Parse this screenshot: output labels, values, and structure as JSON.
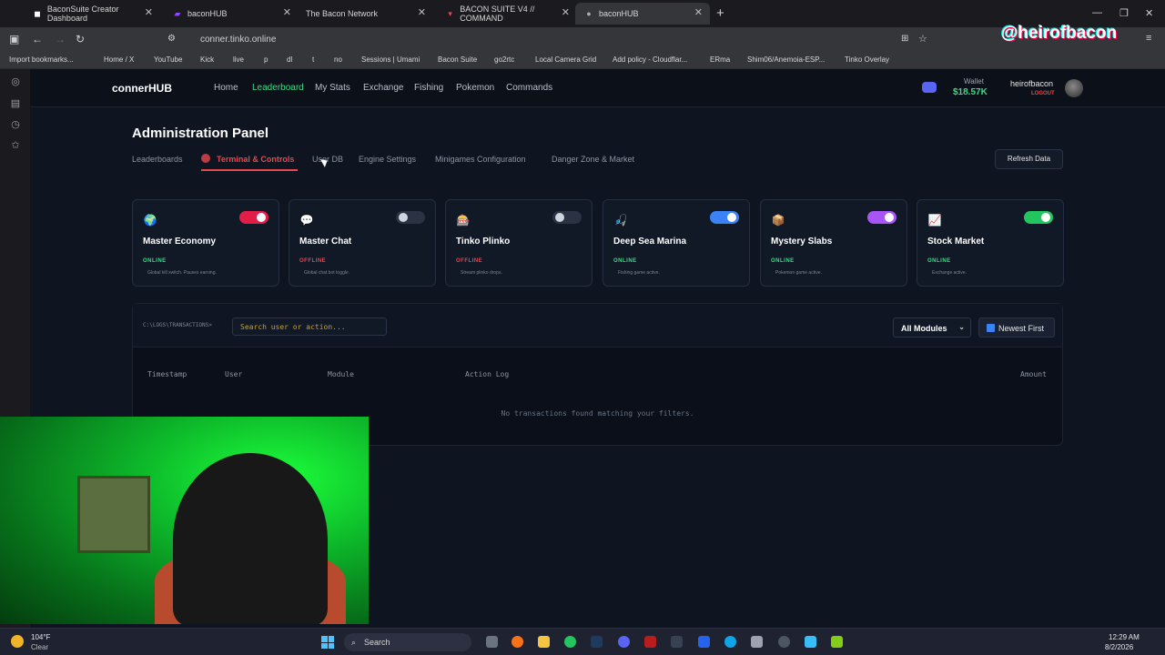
{
  "browser": {
    "tabs": [
      {
        "label": "BaconSuite Creator Dashboard",
        "active": false
      },
      {
        "label": "baconHUB",
        "active": false
      },
      {
        "label": "The Bacon Network",
        "active": false
      },
      {
        "label": "BACON SUITE V4 // COMMAND",
        "active": false
      },
      {
        "label": "baconHUB",
        "active": true
      }
    ],
    "url": "conner.tinko.online",
    "overlay_handle": "@heirofbacon",
    "bookmarks": [
      "Import bookmarks...",
      "Home / X",
      "YouTube",
      "Kick",
      "live",
      "p",
      "dl",
      "t",
      "no",
      "Sessions | Umami",
      "Bacon Suite",
      "go2rtc",
      "Local Camera Grid",
      "Add policy - Cloudflar...",
      "ERma",
      "Shim06/Anemoia-ESP...",
      "Tinko Overlay"
    ]
  },
  "nav": {
    "brand": "connerHUB",
    "links": [
      "Home",
      "Leaderboard",
      "My Stats",
      "Exchange",
      "Fishing",
      "Pokemon",
      "Commands"
    ],
    "active_link": "Leaderboard",
    "wallet_label": "Wallet",
    "wallet_value": "$18.57K",
    "username": "heirofbacon",
    "logout": "LOGOUT"
  },
  "panel": {
    "title": "Administration Panel",
    "tabs": [
      "Leaderboards",
      "Terminal & Controls",
      "User DB",
      "Engine Settings",
      "Minigames Configuration",
      "Danger Zone & Market"
    ],
    "active_tab": "Terminal & Controls",
    "refresh_label": "Refresh Data"
  },
  "modules": [
    {
      "title": "Master Economy",
      "status": "ONLINE",
      "desc": "Global kill switch. Pauses earning.",
      "on": true,
      "color": "#e11d48",
      "icon": "globe-icon",
      "glyph": "🌍"
    },
    {
      "title": "Master Chat",
      "status": "OFFLINE",
      "desc": "Global chat bot toggle.",
      "on": false,
      "color": "#e11d48",
      "icon": "chat-bubble-icon",
      "glyph": "💬"
    },
    {
      "title": "Tinko Plinko",
      "status": "OFFLINE",
      "desc": "Stream plinko drops.",
      "on": false,
      "color": "#e11d48",
      "icon": "pachinko-icon",
      "glyph": "🎰"
    },
    {
      "title": "Deep Sea Marina",
      "status": "ONLINE",
      "desc": "Fishing game active.",
      "on": true,
      "color": "#3b82f6",
      "icon": "fishing-icon",
      "glyph": "🎣"
    },
    {
      "title": "Mystery Slabs",
      "status": "ONLINE",
      "desc": "Pokemon game active.",
      "on": true,
      "color": "#a855f7",
      "icon": "package-icon",
      "glyph": "📦"
    },
    {
      "title": "Stock Market",
      "status": "ONLINE",
      "desc": "Exchange active.",
      "on": true,
      "color": "#22c55e",
      "icon": "chart-icon",
      "glyph": "📈"
    }
  ],
  "log": {
    "path": "C:\\LOGS\\TRANSACTIONS>",
    "search_placeholder": "Search user or action...",
    "module_filter": "All Modules",
    "sort_label": "Newest First",
    "columns": [
      "Timestamp",
      "User",
      "Module",
      "Action Log",
      "Amount"
    ],
    "empty_message": "No transactions found matching your filters."
  },
  "taskbar": {
    "weather_temp": "104°F",
    "weather_cond": "Clear",
    "search_label": "Search",
    "time": "12:29 AM",
    "date": "8/2/2026"
  },
  "colors": {
    "accent_green": "#3ddc84",
    "accent_red": "#e5484d",
    "status_online": "#3ddc84",
    "status_offline": "#e5484d"
  }
}
